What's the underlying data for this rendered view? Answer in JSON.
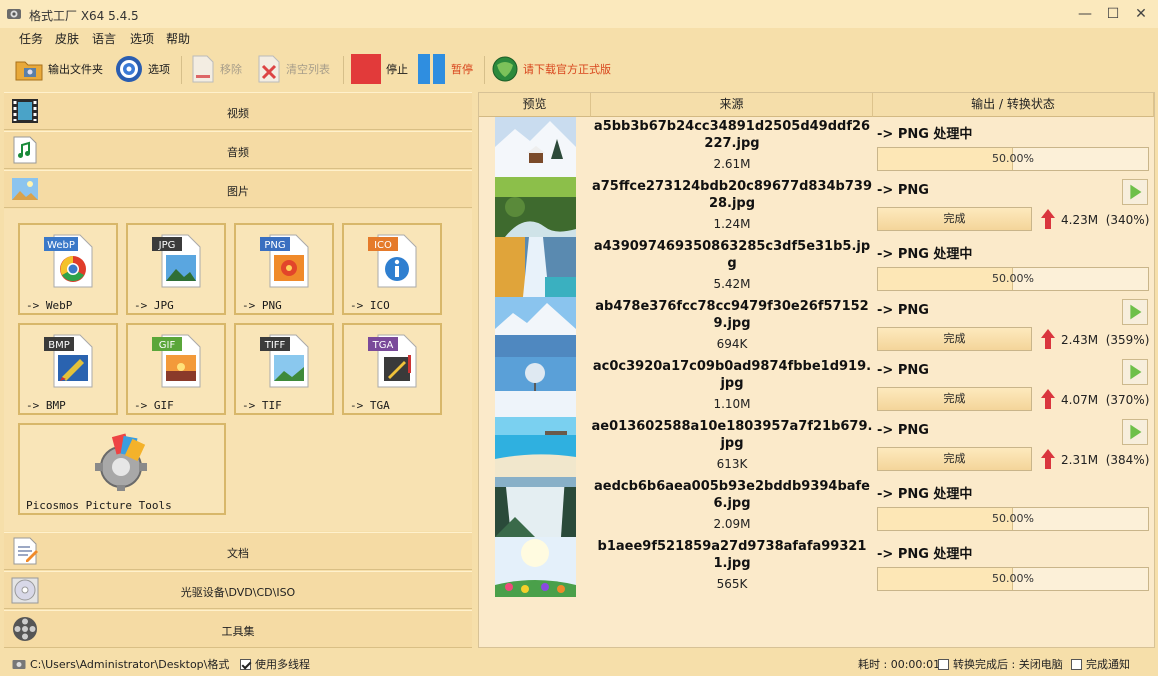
{
  "window": {
    "title": "格式工厂 X64 5.4.5",
    "minimize": "—",
    "maximize": "☐",
    "close": "✕"
  },
  "menu": [
    "任务",
    "皮肤",
    "语言",
    "选项",
    "帮助"
  ],
  "toolbar": {
    "output_folder": "输出文件夹",
    "options": "选项",
    "remove": "移除",
    "clear_list": "清空列表",
    "stop": "停止",
    "pause": "暂停",
    "download": "请下载官方正式版"
  },
  "categories": {
    "video": "视频",
    "audio": "音频",
    "image": "图片",
    "document": "文档",
    "rom": "光驱设备\\DVD\\CD\\ISO",
    "tools": "工具集"
  },
  "image_tools": [
    {
      "badge": "WebP",
      "label": "-> WebP",
      "color": "#3a78c8"
    },
    {
      "badge": "JPG",
      "label": "-> JPG",
      "color": "#3b3b3b"
    },
    {
      "badge": "PNG",
      "label": "-> PNG",
      "color": "#3a6fc0"
    },
    {
      "badge": "ICO",
      "label": "-> ICO",
      "color": "#e57a2a"
    },
    {
      "badge": "BMP",
      "label": "-> BMP",
      "color": "#3b3b3b"
    },
    {
      "badge": "GIF",
      "label": "-> GIF",
      "color": "#5aa63a"
    },
    {
      "badge": "TIFF",
      "label": "-> TIF",
      "color": "#3b3b3b"
    },
    {
      "badge": "TGA",
      "label": "-> TGA",
      "color": "#7a4a9a"
    }
  ],
  "picosmos": "Picosmos Picture Tools",
  "list_headers": {
    "preview": "预览",
    "source": "来源",
    "output": "输出 / 转换状态"
  },
  "tasks": [
    {
      "name": "a5bb3b67b24cc34891d2505d49ddf26227.jpg",
      "size": "2.61M",
      "status": "-> PNG 处理中",
      "state": "progress",
      "percent": "50.00%",
      "progress": 0.5,
      "thumb": "snow"
    },
    {
      "name": "a75ffce273124bdb20c89677d834b73928.jpg",
      "size": "1.24M",
      "status": "-> PNG",
      "state": "done",
      "done": "完成",
      "out_size": "4.23M",
      "ratio": "(340%)",
      "thumb": "forest"
    },
    {
      "name": "a439097469350863285c3df5e31b5.jpg",
      "size": "5.42M",
      "status": "-> PNG 处理中",
      "state": "progress",
      "percent": "50.00%",
      "progress": 0.5,
      "thumb": "waterfall"
    },
    {
      "name": "ab478e376fcc78cc9479f30e26f571529.jpg",
      "size": "694K",
      "status": "-> PNG",
      "state": "done",
      "done": "完成",
      "out_size": "2.43M",
      "ratio": "(359%)",
      "thumb": "mountain"
    },
    {
      "name": "ac0c3920a17c09b0ad9874fbbe1d919.jpg",
      "size": "1.10M",
      "status": "-> PNG",
      "state": "done",
      "done": "完成",
      "out_size": "4.07M",
      "ratio": "(370%)",
      "thumb": "tree"
    },
    {
      "name": "ae013602588a10e1803957a7f21b679.jpg",
      "size": "613K",
      "status": "-> PNG",
      "state": "done",
      "done": "完成",
      "out_size": "2.31M",
      "ratio": "(384%)",
      "thumb": "beach"
    },
    {
      "name": "aedcb6b6aea005b93e2bddb9394bafe6.jpg",
      "size": "2.09M",
      "status": "-> PNG 处理中",
      "state": "progress",
      "percent": "50.00%",
      "progress": 0.5,
      "thumb": "falls"
    },
    {
      "name": "b1aee9f521859a27d9738afafa993211.jpg",
      "size": "565K",
      "status": "-> PNG 处理中",
      "state": "progress",
      "percent": "50.00%",
      "progress": 0.5,
      "thumb": "flowers"
    }
  ],
  "statusbar": {
    "path": "C:\\Users\\Administrator\\Desktop\\格式",
    "multithread": "使用多线程",
    "elapsed": "耗时 : 00:00:01",
    "after_convert": "转换完成后 : 关闭电脑",
    "notify": "完成通知"
  }
}
